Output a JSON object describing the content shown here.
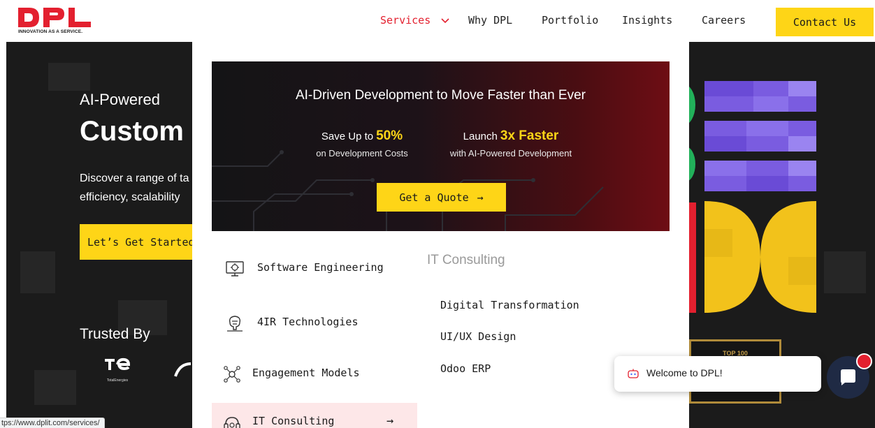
{
  "brand": {
    "logo_text": "DPL",
    "tagline": "INNOVATION AS A SERVICE.",
    "red": "#e3202f",
    "yellow": "#fed517"
  },
  "nav": {
    "items": [
      {
        "label": "Services",
        "active": true
      },
      {
        "label": "Why DPL"
      },
      {
        "label": "Portfolio"
      },
      {
        "label": "Insights"
      },
      {
        "label": "Careers"
      }
    ],
    "contact_label": "Contact Us"
  },
  "hero": {
    "eyebrow": "AI-Powered",
    "title": "Custom S",
    "desc_lines": [
      "Discover a range of ta",
      "efficiency, scalability"
    ],
    "cta_label": "Let’s Get Started",
    "trusted_label": "Trusted By",
    "client_logo_label": "TotalEnergies",
    "award_label": "TOP 100"
  },
  "mega_menu": {
    "promo": {
      "title": "AI-Driven Development to Move Faster than Ever",
      "stats": [
        {
          "prefix": "Save Up to",
          "highlight": "50%",
          "sub": "on Development Costs"
        },
        {
          "prefix": "Launch",
          "highlight": "3x Faster",
          "sub": "with AI-Powered Development"
        }
      ],
      "cta_label": "Get a Quote",
      "cta_arrow": "→"
    },
    "categories": [
      {
        "label": "Software Engineering",
        "icon": "software-engineering-icon"
      },
      {
        "label": "4IR Technologies",
        "icon": "4ir-technologies-icon"
      },
      {
        "label": "Engagement Models",
        "icon": "engagement-models-icon"
      },
      {
        "label": "IT Consulting",
        "icon": "it-consulting-icon",
        "active": true,
        "arrow": "→"
      }
    ],
    "submenu": {
      "heading": "IT Consulting",
      "links": [
        "Digital Transformation",
        "UI/UX Design",
        "Odoo ERP"
      ]
    }
  },
  "chat": {
    "welcome": "Welcome to DPL!",
    "launcher_color": "#1f2a44"
  },
  "status_bar": {
    "url": "tps://www.dplit.com/services/"
  }
}
